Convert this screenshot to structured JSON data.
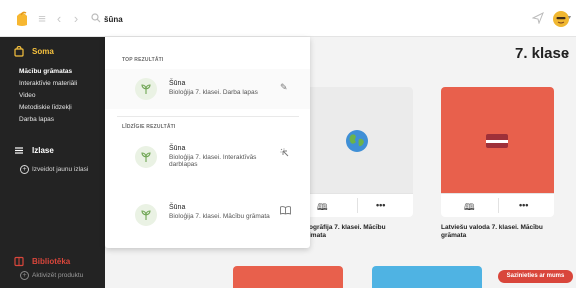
{
  "search": {
    "query": "šūna"
  },
  "sidebar": {
    "soma_label": "Soma",
    "soma_items": [
      "Mācību grāmatas",
      "Interaktīvie materiāli",
      "Video",
      "Metodiskie līdzekļi",
      "Darba lapas"
    ],
    "izlase_label": "Izlase",
    "izlase_add_label": "Izveidot jaunu izlasi",
    "biblioteka_label": "Bibliotēka",
    "biblioteka_add_label": "Aktivizēt produktu"
  },
  "main": {
    "title": "7. klase",
    "cards": [
      {
        "caption_line1": "ogrāfija 7. klasei. Mācību",
        "caption_line2": "imata",
        "cover_color": "#ebebeb"
      },
      {
        "caption_line1": "Latviešu valoda 7. klasei. Mācību",
        "caption_line2": "grāmata",
        "cover_color": "#e8604c"
      }
    ],
    "contact_button": "Sazinieties ar mums"
  },
  "dropdown": {
    "top_section_label": "TOP REZULTĀTI",
    "related_section_label": "LĪDZĪGIE REZULTĀTI",
    "top_result": {
      "title": "Šūna",
      "subtitle": "Bioloģija 7. klasei. Darba lapas"
    },
    "related_results": [
      {
        "title": "Šūna",
        "subtitle": "Bioloģija 7. klasei. Interaktīvās darblapas"
      },
      {
        "title": "Šūna",
        "subtitle": "Bioloģija 7. klasei. Mācību grāmata"
      }
    ]
  },
  "colors": {
    "accent_yellow": "#f7c23e",
    "accent_red": "#d9463b",
    "sidebar_bg": "#232323"
  },
  "icons": [
    "logo-icon",
    "menu-icon",
    "back-icon",
    "forward-icon",
    "search-icon",
    "send-icon",
    "avatar-icon",
    "bag-icon",
    "list-icon",
    "add-icon",
    "book-icon",
    "more-icon",
    "globe-icon",
    "flag-icon",
    "leaf-icon",
    "pencil-icon",
    "interactive-icon"
  ]
}
